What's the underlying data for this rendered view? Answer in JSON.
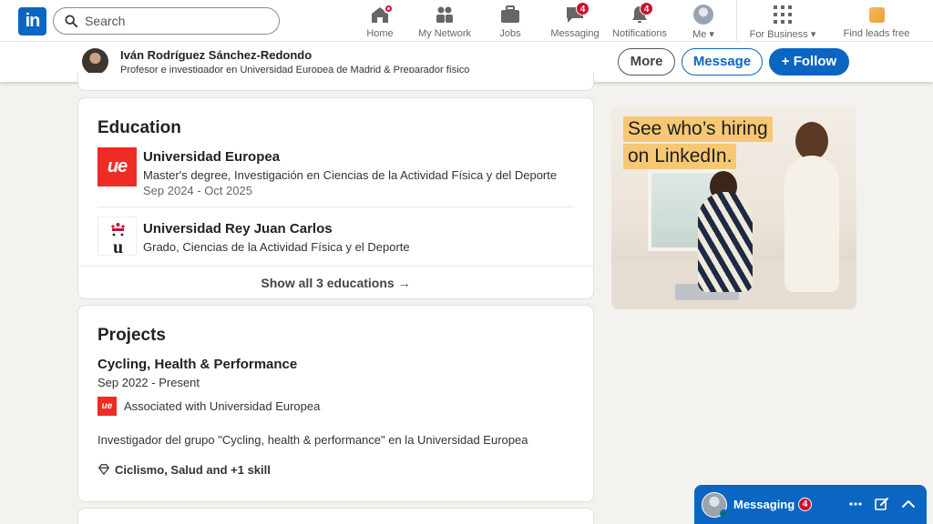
{
  "nav": {
    "search_placeholder": "Search",
    "items": [
      {
        "label": "Home",
        "icon": "home-icon"
      },
      {
        "label": "My Network",
        "icon": "network-icon"
      },
      {
        "label": "Jobs",
        "icon": "jobs-icon"
      },
      {
        "label": "Messaging",
        "icon": "messaging-icon",
        "badge": "4"
      },
      {
        "label": "Notifications",
        "icon": "notifications-icon",
        "badge": "4"
      },
      {
        "label": "Me",
        "icon": "avatar"
      },
      {
        "label": "For Business",
        "icon": "grid-icon"
      },
      {
        "label": "Find leads free",
        "icon": "sales-navigator-icon"
      }
    ]
  },
  "profile_bar": {
    "name": "Iván Rodríguez Sánchez-Redondo",
    "headline": "Profesor e investigador en Universidad Europea de Madrid & Preparador físico",
    "more_label": "More",
    "message_label": "Message",
    "follow_label": "+ Follow"
  },
  "education": {
    "title": "Education",
    "entries": [
      {
        "school": "Universidad Europea",
        "logo_text": "ue",
        "degree": "Master's degree, Investigación en Ciencias de la Actividad Física y del Deporte",
        "dates": "Sep 2024 - Oct 2025"
      },
      {
        "school": "Universidad Rey Juan Carlos",
        "logo_text": "u",
        "degree": "Grado, Ciencias de la Actividad Física y el Deporte"
      }
    ],
    "show_all": "Show all 3 educations →"
  },
  "projects": {
    "title": "Projects",
    "entries": [
      {
        "name": "Cycling, Health & Performance",
        "dates": "Sep 2022 - Present",
        "logo_text": "ue",
        "associated": "Associated with Universidad Europea",
        "description": "Investigador del grupo \"Cycling, health & performance\" en la Universidad Europea",
        "skills": "Ciclismo, Salud and +1 skill"
      }
    ]
  },
  "ad": {
    "line1": "See who’s hiring",
    "line2": "on LinkedIn."
  },
  "messaging": {
    "label": "Messaging",
    "badge": "4"
  },
  "colors": {
    "brand": "#0a66c2",
    "badge": "#cb112d",
    "ue_red": "#ee2c24",
    "ad_highlight": "#f7c873"
  }
}
